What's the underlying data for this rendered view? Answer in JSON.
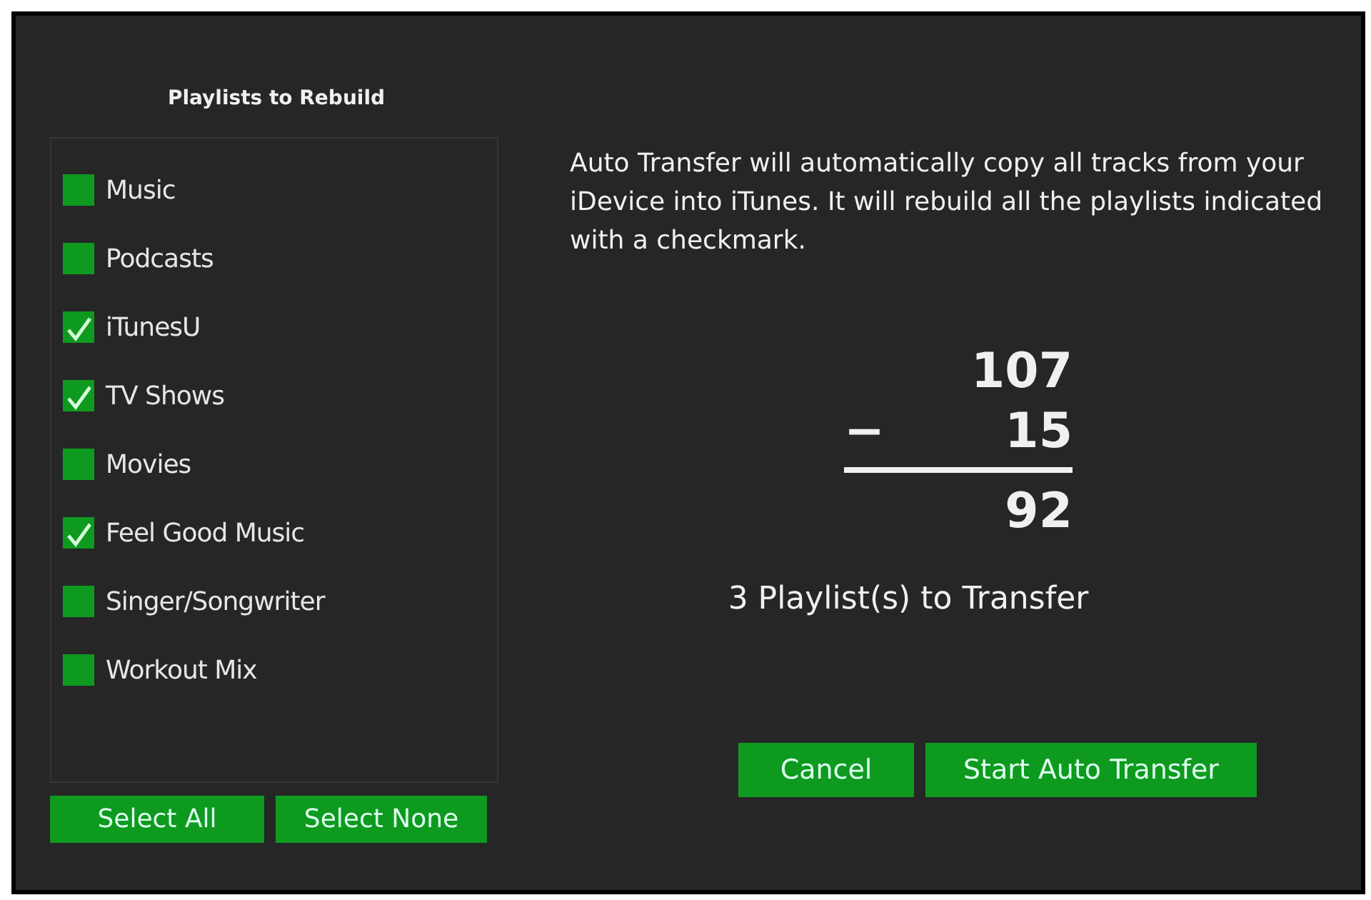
{
  "playlists_panel": {
    "title": "Playlists to Rebuild",
    "items": [
      {
        "label": "Music",
        "checked": false
      },
      {
        "label": "Podcasts",
        "checked": false
      },
      {
        "label": "iTunesU",
        "checked": true
      },
      {
        "label": "TV Shows",
        "checked": true
      },
      {
        "label": "Movies",
        "checked": false
      },
      {
        "label": "Feel Good Music",
        "checked": true
      },
      {
        "label": "Singer/Songwriter",
        "checked": false
      },
      {
        "label": "Workout Mix",
        "checked": false
      }
    ],
    "buttons": [
      "Select All",
      "Select None"
    ]
  },
  "description": "Auto Transfer will automatically copy all tracks from your iDevice into iTunes.  It will rebuild all the playlists indicated with a checkmark.",
  "calculation": {
    "total": "107",
    "operator": "−",
    "subtracted": "15",
    "result": "92"
  },
  "summary": "3 Playlist(s) to Transfer",
  "buttons": [
    "Cancel",
    "Start Auto Transfer"
  ]
}
